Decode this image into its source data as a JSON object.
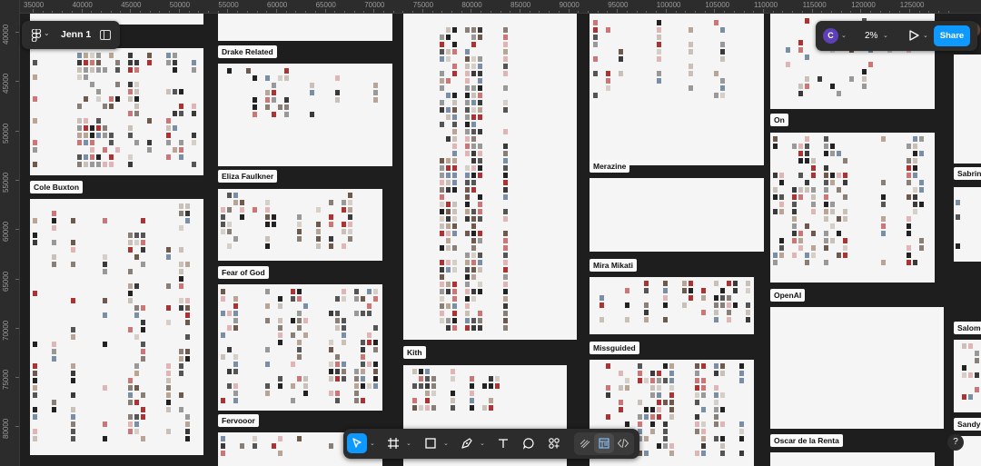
{
  "file": {
    "title": "Jenn 1"
  },
  "ruler": {
    "x_labels": [
      "35000",
      "40000",
      "45000",
      "50000",
      "55000",
      "60000",
      "65000",
      "70000",
      "75000",
      "80000",
      "85000",
      "90000",
      "95000",
      "100000",
      "105000",
      "110000",
      "115000",
      "120000",
      "125000"
    ],
    "y_labels": [
      "40000",
      "45000",
      "50000",
      "55000",
      "60000",
      "65000",
      "70000",
      "75000",
      "80000"
    ]
  },
  "frames": {
    "drake": "Drake Related",
    "eliza": "Eliza Faulkner",
    "fear": "Fear of God",
    "fervooor": "Fervooor",
    "cole": "Cole Buxton",
    "kith": "Kith",
    "merazine": "Merazine",
    "mira": "Mira Mikati",
    "missguided": "Missguided",
    "on": "On",
    "openai": "OpenAI",
    "oscar": "Oscar de la Renta",
    "sabrina": "Sabrina",
    "salomon": "Salomo",
    "sandy": "Sandy"
  },
  "collab": {
    "avatar_initial": "C",
    "zoom": "2%",
    "share_label": "Share"
  },
  "toolbar": {
    "tools": [
      "move-tool",
      "frame-tool",
      "shape-tool",
      "pen-tool",
      "text-tool",
      "comment-tool",
      "actions-tool"
    ],
    "modes": [
      "draw-mode",
      "design-mode",
      "dev-mode"
    ],
    "active_tool": "move-tool",
    "active_mode": "design-mode"
  },
  "help_label": "?",
  "colors": {
    "accent": "#0d99ff",
    "canvas": "#1e1e1e",
    "toolbar": "#2c2c2c",
    "avatar": "#5d3fb8"
  }
}
